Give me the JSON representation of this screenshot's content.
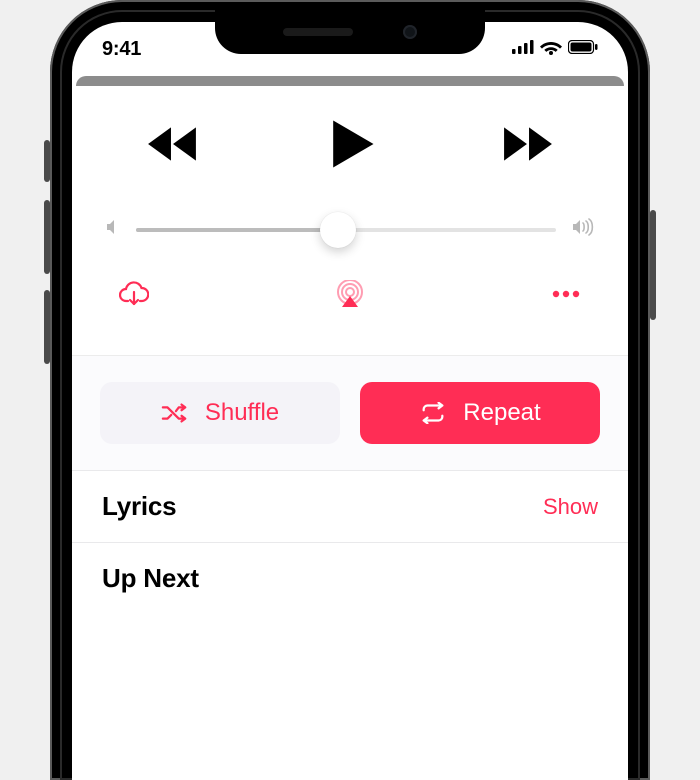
{
  "status": {
    "time": "9:41"
  },
  "colors": {
    "accent": "#ff2d55"
  },
  "volume": {
    "percent": 48
  },
  "pair": {
    "shuffle_label": "Shuffle",
    "repeat_label": "Repeat"
  },
  "rows": {
    "lyrics_title": "Lyrics",
    "lyrics_action": "Show",
    "upnext_title": "Up Next"
  }
}
